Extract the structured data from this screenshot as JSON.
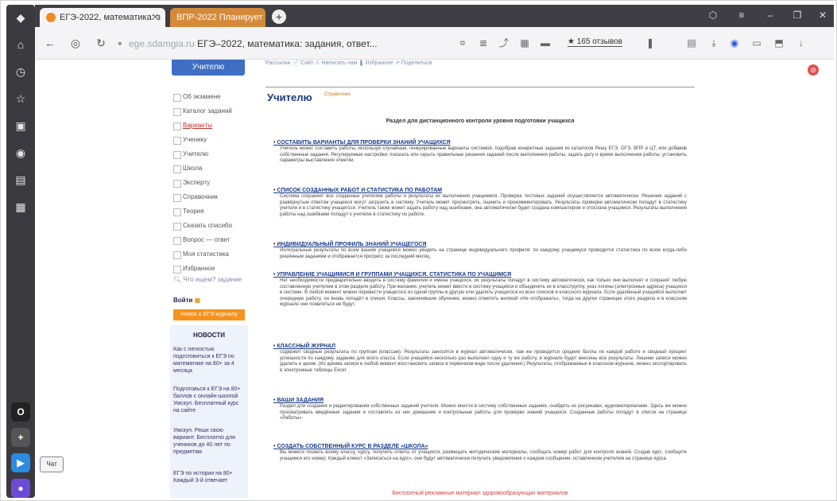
{
  "browser": {
    "tabs": [
      {
        "label": "ЕГЭ-2022, математика: з"
      },
      {
        "label": "ВПР-2022 Планирует"
      }
    ],
    "address": {
      "domain": "ege.sdamgia.ru",
      "title": "ЕГЭ–2022, математика: задания, ответ..."
    },
    "reviews_label": "★ 165 отзывов"
  },
  "sidebar": {
    "top_tab": "Учителю",
    "items": [
      {
        "label": "Об экзамене"
      },
      {
        "label": "Каталог заданий"
      },
      {
        "label": "Варианты"
      },
      {
        "label": "Ученику"
      },
      {
        "label": "Учителю"
      },
      {
        "label": "Школа"
      },
      {
        "label": "Эксперту"
      },
      {
        "label": "Справочник"
      },
      {
        "label": "Теория"
      },
      {
        "label": "Сказать спасибо"
      },
      {
        "label": "Вопрос — ответ"
      },
      {
        "label": "Моя статистика"
      },
      {
        "label": "Избранное"
      }
    ],
    "search_placeholder": "Что ищем? задание",
    "login_label": "Войти",
    "promo_label": "Новое о ЕГЭ-журналу",
    "news_title": "НОВОСТИ",
    "news": [
      {
        "date": "",
        "text": "Как с легкостью подготовиться к ЕГЭ по математике на 80+ за 4 месяца"
      },
      {
        "date": "",
        "text": "Подготовься к ЕГЭ на 80+ баллов с онлайн-школой Умскул. Бесплатный курс на сайте"
      },
      {
        "date": "",
        "text": "Умскул. Реши свою вариант. Бесплатно для учеников до 40 лет по предметам"
      },
      {
        "date": "",
        "text": "ЕГЭ по истории на 80+ Каждый 3-й отвечает"
      }
    ]
  },
  "main": {
    "topmenu": "Рассылки   📄 Сайт   ⚠ Написать нам   ❚ Избранное   ↗ Поделиться",
    "title": "Учителю",
    "title_sup": "Справочник",
    "subtitle": "Раздел для дистанционного контроля уровня подготовки учащихся",
    "sections": [
      {
        "heading": "СОСТАВИТЬ ВАРИАНТЫ ДЛЯ ПРОВЕРКИ ЗНАНИЙ УЧАЩИХСЯ",
        "body": "Учитель может составить работы, используя случайные, генерированные варианты системой, подобрав конкретные задания из каталогов Решу ЕГЭ, ОГЭ, ВПР и ЦТ, или добавив собственные задания. Регулируемые настройки: показать или скрыть правильные решения заданий после выполнения работы, задать дату и время выполнения работы, установить параметры выставления отметки."
      },
      {
        "heading": "СПИСОК СОЗДАННЫХ РАБОТ И СТАТИСТИКА ПО РАБОТАМ",
        "body": "Система сохраняет все созданные учителем работы и результаты их выполнения учащимися. Проверка тестовых заданий осуществляется автоматически. Решения заданий с развёрнутым ответом учащиеся могут загрузить в систему. Учитель может просмотреть, оценить и прокомментировать. Результаты проверки автоматически попадут в статистику учителя и в статистику учащегося. Учитель также может задать работу над ошибками, она автоматически будет создана компьютером и отослана учащимся. Результаты выполнения работы над ошибками попадут к учителю в статистику по работе."
      },
      {
        "heading": "ИНДИВИДУАЛЬНЫЙ ПРОФИЛЬ ЗНАНИЙ УЧАЩЕГОСЯ",
        "body": "Интегральные результаты по всем вашим учащимся можно увидеть на странице индивидуального профиля: по каждому учащемуся проводится статистика по всем когда-либо решённым заданиям и отображается прогресс за последний месяц."
      },
      {
        "heading": "УПРАВЛЕНИЕ УЧАЩИМИСЯ И ГРУППАМИ УЧАЩИХСЯ. СТАТИСТИКА ПО УЧАЩИМСЯ",
        "body": "Нет необходимости предварительно вводить в систему фамилии и имена учащихся, их результаты попадут в систему автоматически, как только они выполнят и сохранят любую составленную учителем в этом разделе работу. При желании, учитель может ввести в систему учащихся и объединить их в класс/группу, указ логины (электронные адреса) учащихся в системе. В любой момент можно перевести учащегося из одной группы в другую или удалить учащегося из всех списков и классного журнала. Если удалённый учащийся выполнит очередную работу, он вновь попадёт в списки. Классы, закончившие обучение, можно отметить кнопкой «Не отображать», тогда на других страницах этого раздела и в классном журнале они появляться не будут."
      },
      {
        "heading": "КЛАССНЫЙ ЖУРНАЛ",
        "body": "содержит сводные результаты по группам (классам). Результаты заносятся в журнал автоматически, там же проводится средние баллы по каждой работе и сводный процент успешности по каждому заданию для всего класса. Если учащийся несколько раз выполнял одну и ту же работу, в журнале будет внесены все результаты. Лишние записи можно удалить в архив. (Из архива записи в любой момент восстановить записи в первичном виде после удаления.) Результаты, отображаемые в классном журнале, можно экспортировать в электронные таблицы Excel."
      },
      {
        "heading": "ВАШИ ЗАДАНИЯ",
        "body": "Раздел для создания и редактирования собственных заданий учителя. Можно внести в систему собственные задания, снабдить их рисунками, аудиоматериалами. Здесь же можно просматривать введённые задания и составлять из них домашние и контрольные работы для проверки знаний учащихся. Созданные работы попадут в список на странице «Работы»."
      },
      {
        "heading": "СОЗДАТЬ СОБСТВЕННЫЙ КУРС В РАЗДЕЛЕ «ШКОЛА»",
        "body": "Вы можете позвать всему классу, курсу, получить ответы от учащихся, размещать методические материалы, сообщать номер работ для контроля знаний. Создав курс, сообщите учащимся его номер. Каждый клиент «Записаться на курс», они будут автоматически получать уведомления о каждом сообщении, оставленном учителем на странице курса."
      }
    ],
    "footer_note": "Бесплатный рекламные материал здоровообразующих материалов"
  },
  "chat_label": "Чат",
  "colors": {
    "accent": "#3f6fc5",
    "link": "#1a3a8a",
    "orange": "#f5921e"
  }
}
